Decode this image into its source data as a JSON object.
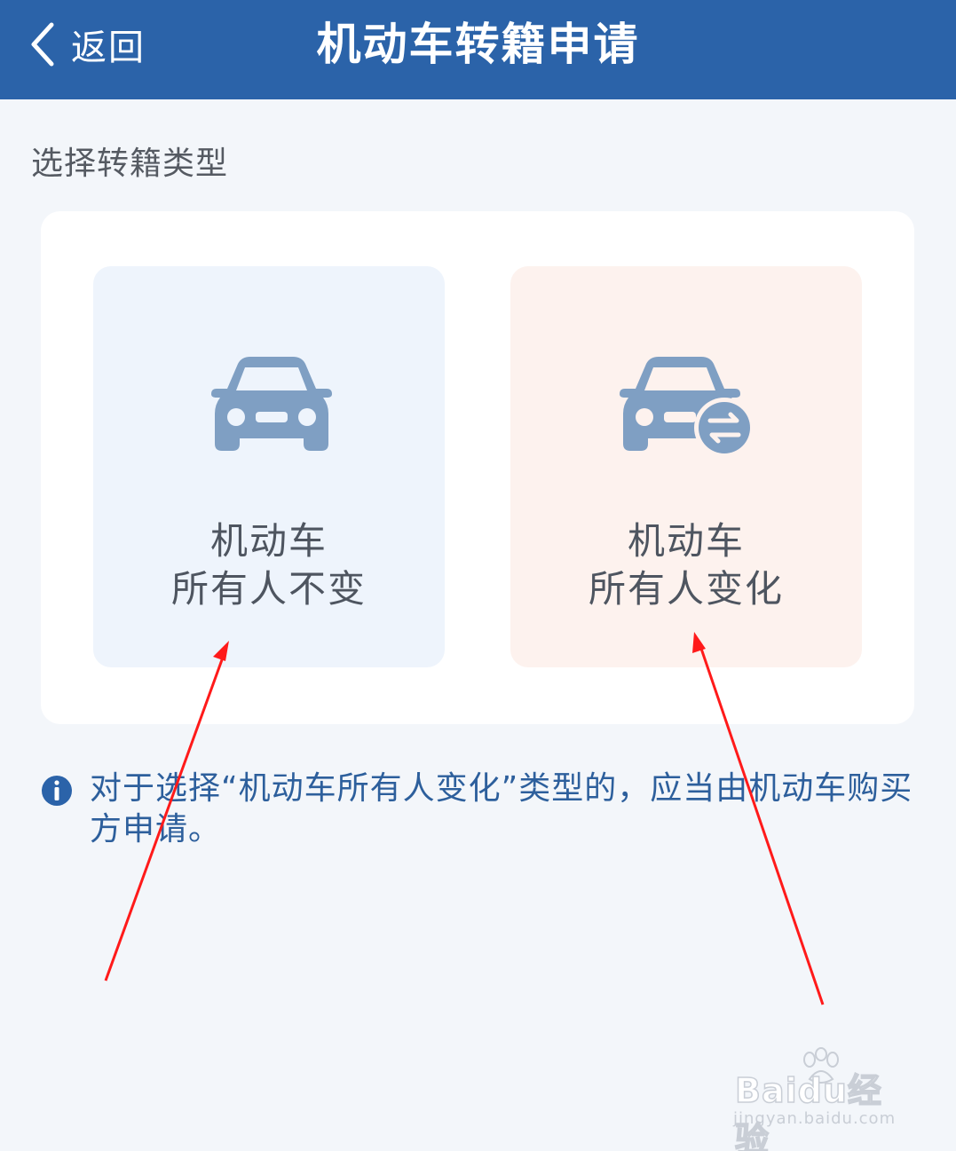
{
  "header": {
    "back_label": "返回",
    "title": "机动车转籍申请"
  },
  "section_label": "选择转籍类型",
  "options": [
    {
      "line1": "机动车",
      "line2": "所有人不变",
      "icon": "car-icon",
      "bg": "#eef4fc"
    },
    {
      "line1": "机动车",
      "line2": "所有人变化",
      "icon": "car-transfer-icon",
      "bg": "#fdf2ee"
    }
  ],
  "notice": {
    "icon": "info-icon",
    "text": "对于选择“机动车所有人变化”类型的，应当由机动车购买方申请。"
  },
  "watermark": {
    "main": "Baidu经验",
    "sub": "jingyan.baidu.com"
  },
  "colors": {
    "header_bg": "#2b63a9",
    "icon": "#7f9fc3",
    "notice_text": "#2d5f9c",
    "annotation_arrow": "#ff1a1a"
  }
}
